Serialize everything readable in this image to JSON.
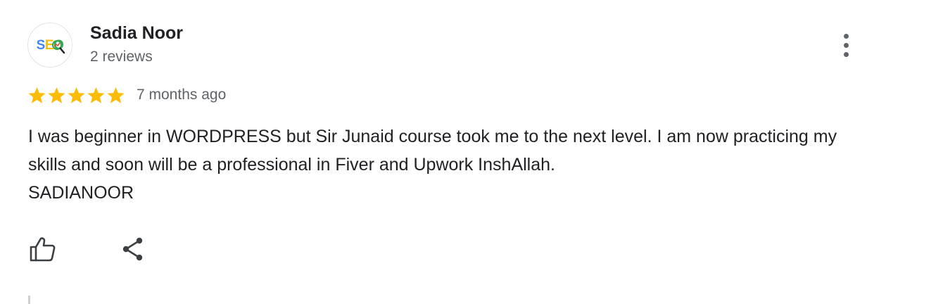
{
  "review": {
    "author": {
      "name": "Sadia Noor",
      "meta": "2 reviews",
      "avatar": {
        "logo_text_s": "S",
        "logo_text_e": "E",
        "logo_text_o": "O",
        "colors": {
          "s": "#4285f4",
          "e": "#fbbc05",
          "o": "#34a853",
          "magnifier": "#ea4335"
        }
      }
    },
    "rating": {
      "value": 5,
      "max": 5,
      "star_color": "#fbbc04"
    },
    "date": "7 months ago",
    "text_lines": [
      "I was beginner in WORDPRESS but Sir Junaid course took me to the next level. I am now practicing my skills and soon will be a professional in Fiver and Upwork InshAllah.",
      "SADIANOOR"
    ],
    "actions": {
      "like_icon": "thumbs-up-icon",
      "share_icon": "share-icon",
      "more_icon": "more-vert-icon"
    }
  }
}
